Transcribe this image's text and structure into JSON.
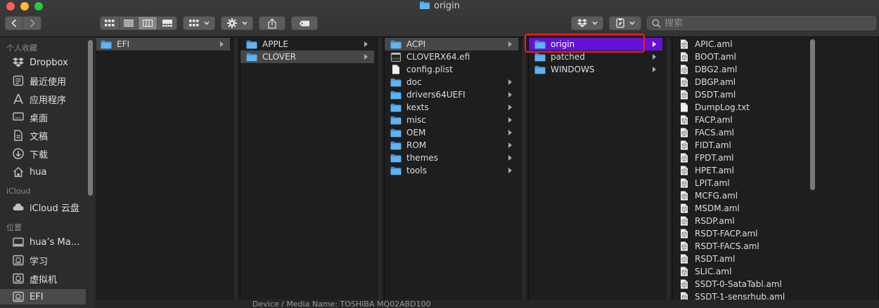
{
  "window": {
    "title": "origin"
  },
  "toolbar": {
    "view_modes": [
      "icon-view",
      "list-view",
      "column-view",
      "gallery-view"
    ],
    "active_view": "column-view",
    "search_placeholder": "搜索"
  },
  "sidebar": {
    "sections": [
      {
        "header": "个人收藏",
        "items": [
          {
            "label": "Dropbox",
            "icon": "dropbox-icon"
          },
          {
            "label": "最近使用",
            "icon": "recents-icon"
          },
          {
            "label": "应用程序",
            "icon": "applications-icon"
          },
          {
            "label": "桌面",
            "icon": "desktop-icon"
          },
          {
            "label": "文稿",
            "icon": "documents-icon"
          },
          {
            "label": "下载",
            "icon": "downloads-icon"
          },
          {
            "label": "hua",
            "icon": "home-icon"
          }
        ]
      },
      {
        "header": "iCloud",
        "items": [
          {
            "label": "iCloud 云盘",
            "icon": "icloud-icon"
          }
        ]
      },
      {
        "header": "位置",
        "items": [
          {
            "label": "hua’s Mac...",
            "icon": "computer-icon"
          },
          {
            "label": "学习",
            "icon": "disk-icon"
          },
          {
            "label": "虚拟机",
            "icon": "disk-icon"
          },
          {
            "label": "EFI",
            "icon": "disk-icon",
            "selected": true
          }
        ]
      }
    ]
  },
  "columns": [
    {
      "items": [
        {
          "name": "EFI",
          "type": "folder",
          "selected": true
        }
      ]
    },
    {
      "items": [
        {
          "name": "APPLE",
          "type": "folder"
        },
        {
          "name": "CLOVER",
          "type": "folder",
          "selected": true
        }
      ]
    },
    {
      "items": [
        {
          "name": "ACPI",
          "type": "folder",
          "selected": true
        },
        {
          "name": "CLOVERX64.efi",
          "type": "exec"
        },
        {
          "name": "config.plist",
          "type": "file"
        },
        {
          "name": "doc",
          "type": "folder"
        },
        {
          "name": "drivers64UEFI",
          "type": "folder"
        },
        {
          "name": "kexts",
          "type": "folder"
        },
        {
          "name": "misc",
          "type": "folder"
        },
        {
          "name": "OEM",
          "type": "folder"
        },
        {
          "name": "ROM",
          "type": "folder"
        },
        {
          "name": "themes",
          "type": "folder"
        },
        {
          "name": "tools",
          "type": "folder"
        }
      ]
    },
    {
      "items": [
        {
          "name": "origin",
          "type": "folder",
          "active": true
        },
        {
          "name": "patched",
          "type": "folder"
        },
        {
          "name": "WINDOWS",
          "type": "folder"
        }
      ]
    },
    {
      "items": [
        {
          "name": "APIC.aml",
          "type": "aml"
        },
        {
          "name": "BOOT.aml",
          "type": "aml"
        },
        {
          "name": "DBG2.aml",
          "type": "aml"
        },
        {
          "name": "DBGP.aml",
          "type": "aml"
        },
        {
          "name": "DSDT.aml",
          "type": "aml"
        },
        {
          "name": "DumpLog.txt",
          "type": "file"
        },
        {
          "name": "FACP.aml",
          "type": "aml"
        },
        {
          "name": "FACS.aml",
          "type": "aml"
        },
        {
          "name": "FIDT.aml",
          "type": "aml"
        },
        {
          "name": "FPDT.aml",
          "type": "aml"
        },
        {
          "name": "HPET.aml",
          "type": "aml"
        },
        {
          "name": "LPIT.aml",
          "type": "aml"
        },
        {
          "name": "MCFG.aml",
          "type": "aml"
        },
        {
          "name": "MSDM.aml",
          "type": "aml"
        },
        {
          "name": "RSDP.aml",
          "type": "aml"
        },
        {
          "name": "RSDT-FACP.aml",
          "type": "aml"
        },
        {
          "name": "RSDT-FACS.aml",
          "type": "aml"
        },
        {
          "name": "RSDT.aml",
          "type": "aml"
        },
        {
          "name": "SLIC.aml",
          "type": "aml"
        },
        {
          "name": "SSDT-0-SataTabl.aml",
          "type": "aml"
        },
        {
          "name": "SSDT-1-sensrhub.aml",
          "type": "aml"
        }
      ]
    }
  ],
  "background_window": {
    "text": "Device / Media Name:    TOSHIBA MQ02ABD100"
  },
  "colors": {
    "active_selection": "#6412d8",
    "folder": "#4aa3e8",
    "highlight_box": "#ff1a1a"
  }
}
